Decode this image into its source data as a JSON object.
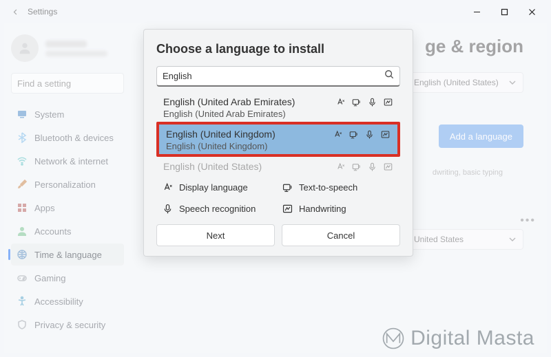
{
  "window": {
    "app_title": "Settings"
  },
  "sidebar": {
    "search_placeholder": "Find a setting",
    "items": [
      {
        "label": "System",
        "icon": "system-icon",
        "color": "#3b82c4"
      },
      {
        "label": "Bluetooth & devices",
        "icon": "bluetooth-icon",
        "color": "#6fb7e8"
      },
      {
        "label": "Network & internet",
        "icon": "wifi-icon",
        "color": "#56c2c2"
      },
      {
        "label": "Personalization",
        "icon": "brush-icon",
        "color": "#c77d3a"
      },
      {
        "label": "Apps",
        "icon": "apps-icon",
        "color": "#b0514a"
      },
      {
        "label": "Accounts",
        "icon": "account-icon",
        "color": "#6bbf84"
      },
      {
        "label": "Time & language",
        "icon": "clock-globe-icon",
        "color": "#6b99c7",
        "active": true
      },
      {
        "label": "Gaming",
        "icon": "gaming-icon",
        "color": "#9aa0a6"
      },
      {
        "label": "Accessibility",
        "icon": "accessibility-icon",
        "color": "#4aa0c7"
      },
      {
        "label": "Privacy & security",
        "icon": "shield-icon",
        "color": "#9aa0a6"
      }
    ]
  },
  "main": {
    "page_title_suffix": "ge & region",
    "display_language_value": "English (United States)",
    "add_language_label": "Add a language",
    "hint_text": "dwriting, basic typing",
    "region_value": "United States"
  },
  "dialog": {
    "title": "Choose a language to install",
    "search_value": "English",
    "languages": [
      {
        "primary": "English (United Arab Emirates)",
        "sub": "English (United Arab Emirates)",
        "selected": false,
        "disabled": false,
        "highlight": false,
        "icons_muted": false
      },
      {
        "primary": "English (United Kingdom)",
        "sub": "English (United Kingdom)",
        "selected": true,
        "disabled": false,
        "highlight": true,
        "icons_muted": false
      },
      {
        "primary": "English (United States)",
        "sub": "",
        "selected": false,
        "disabled": true,
        "highlight": false,
        "icons_muted": true
      }
    ],
    "legend": {
      "display_language": "Display language",
      "text_to_speech": "Text-to-speech",
      "speech_recognition": "Speech recognition",
      "handwriting": "Handwriting"
    },
    "buttons": {
      "next": "Next",
      "cancel": "Cancel"
    }
  },
  "watermark": "Digital Masta"
}
